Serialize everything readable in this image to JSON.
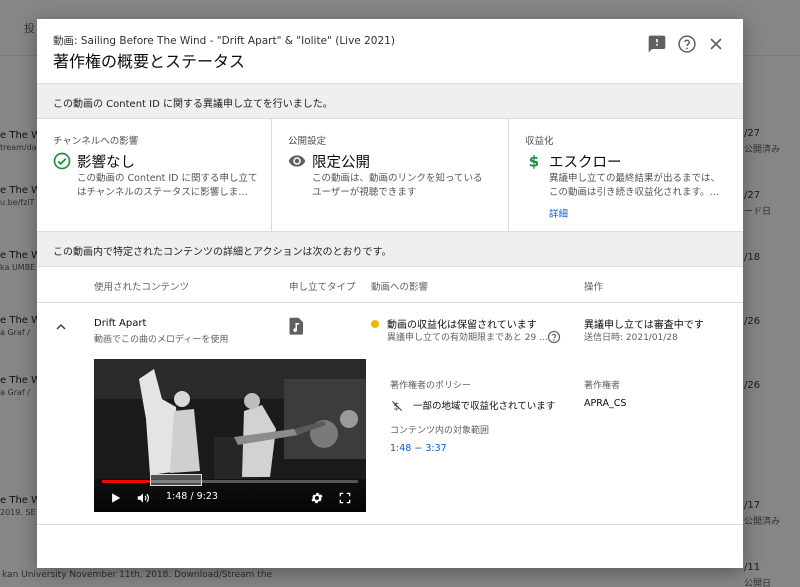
{
  "background": {
    "header_fragment": "投",
    "left_rows": [
      {
        "l1": "e The Wi",
        "l2": "tream/da"
      },
      {
        "l1": "e The Wi",
        "l2": "u.be/fziT"
      },
      {
        "l1": "e The Wi",
        "l2": "ka UMBE"
      },
      {
        "l1": "e The Wi",
        "l2": "a Graf /"
      },
      {
        "l1": "e The Wi",
        "l2": "a Graf /"
      },
      {
        "l1": "e The Wi",
        "l2": "2019. SE"
      }
    ],
    "right_rows": [
      {
        "r1": "/27",
        "r2": "公開済み"
      },
      {
        "r1": "/27",
        "r2": "ード日"
      },
      {
        "r1": "/18",
        "r2": ""
      },
      {
        "r1": "/26",
        "r2": ""
      },
      {
        "r1": "/26",
        "r2": ""
      },
      {
        "r1": "/17",
        "r2": "公開済み"
      },
      {
        "r1": "/11",
        "r2": "公開日"
      }
    ],
    "bottom_text": "kan University November 11th, 2018. Download/Stream the"
  },
  "dialog": {
    "subtitle": "動画: Sailing Before The Wind - \"Drift Apart\" & \"Iolite\" (Live 2021)",
    "title": "著作権の概要とステータス",
    "notice": "この動画の Content ID に関する異議申し立てを行いました。",
    "cards": [
      {
        "label": "チャンネルへの影響",
        "value": "影響なし",
        "icon": "check-circle-icon",
        "desc_line1": "この動画の Content ID に関する申し立て",
        "desc_line2": "はチャンネルのステータスに影響しま…",
        "link": ""
      },
      {
        "label": "公開設定",
        "value": "限定公開",
        "icon": "eye-icon",
        "desc_line1": "この動画は、動画のリンクを知っている",
        "desc_line2": "ユーザーが視聴できます",
        "link": ""
      },
      {
        "label": "収益化",
        "value": "エスクロー",
        "icon": "dollar-icon",
        "desc_line1": "異議申し立ての最終結果が出るまでは、",
        "desc_line2": "この動画は引き続き収益化されます。…",
        "link": "詳細"
      }
    ],
    "section_text": "この動画内で特定されたコンテンツの詳細とアクションは次のとおりです。",
    "table_headers": {
      "content": "使用されたコンテンツ",
      "type": "申し立てタイプ",
      "impact": "動画への影響",
      "action": "操作"
    },
    "row": {
      "title": "Drift Apart",
      "subtitle": "動画でこの曲のメロディーを使用",
      "type_icon": "music-note-icon",
      "impact_title": "動画の収益化は保留されています",
      "impact_sub": "異議申し立ての有効期限まであと 29 …",
      "action_title": "異議申し立ては審査中です",
      "action_sub": "送信日時: 2021/01/28",
      "policy_label": "著作権者のポリシー",
      "policy_value": "一部の地域で収益化されています",
      "owner_label": "著作権者",
      "owner_value": "APRA_CS",
      "range_label": "コンテンツ内の対象範囲",
      "range_value": "1:48 − 3:37",
      "video": {
        "time": "1:48 / 9:23",
        "progress": 0.19
      }
    }
  },
  "colors": {
    "accent_link": "#065fd4",
    "check_green": "#1e8e3e",
    "status_yellow": "#f2b705",
    "progress_red": "#ff0000"
  }
}
